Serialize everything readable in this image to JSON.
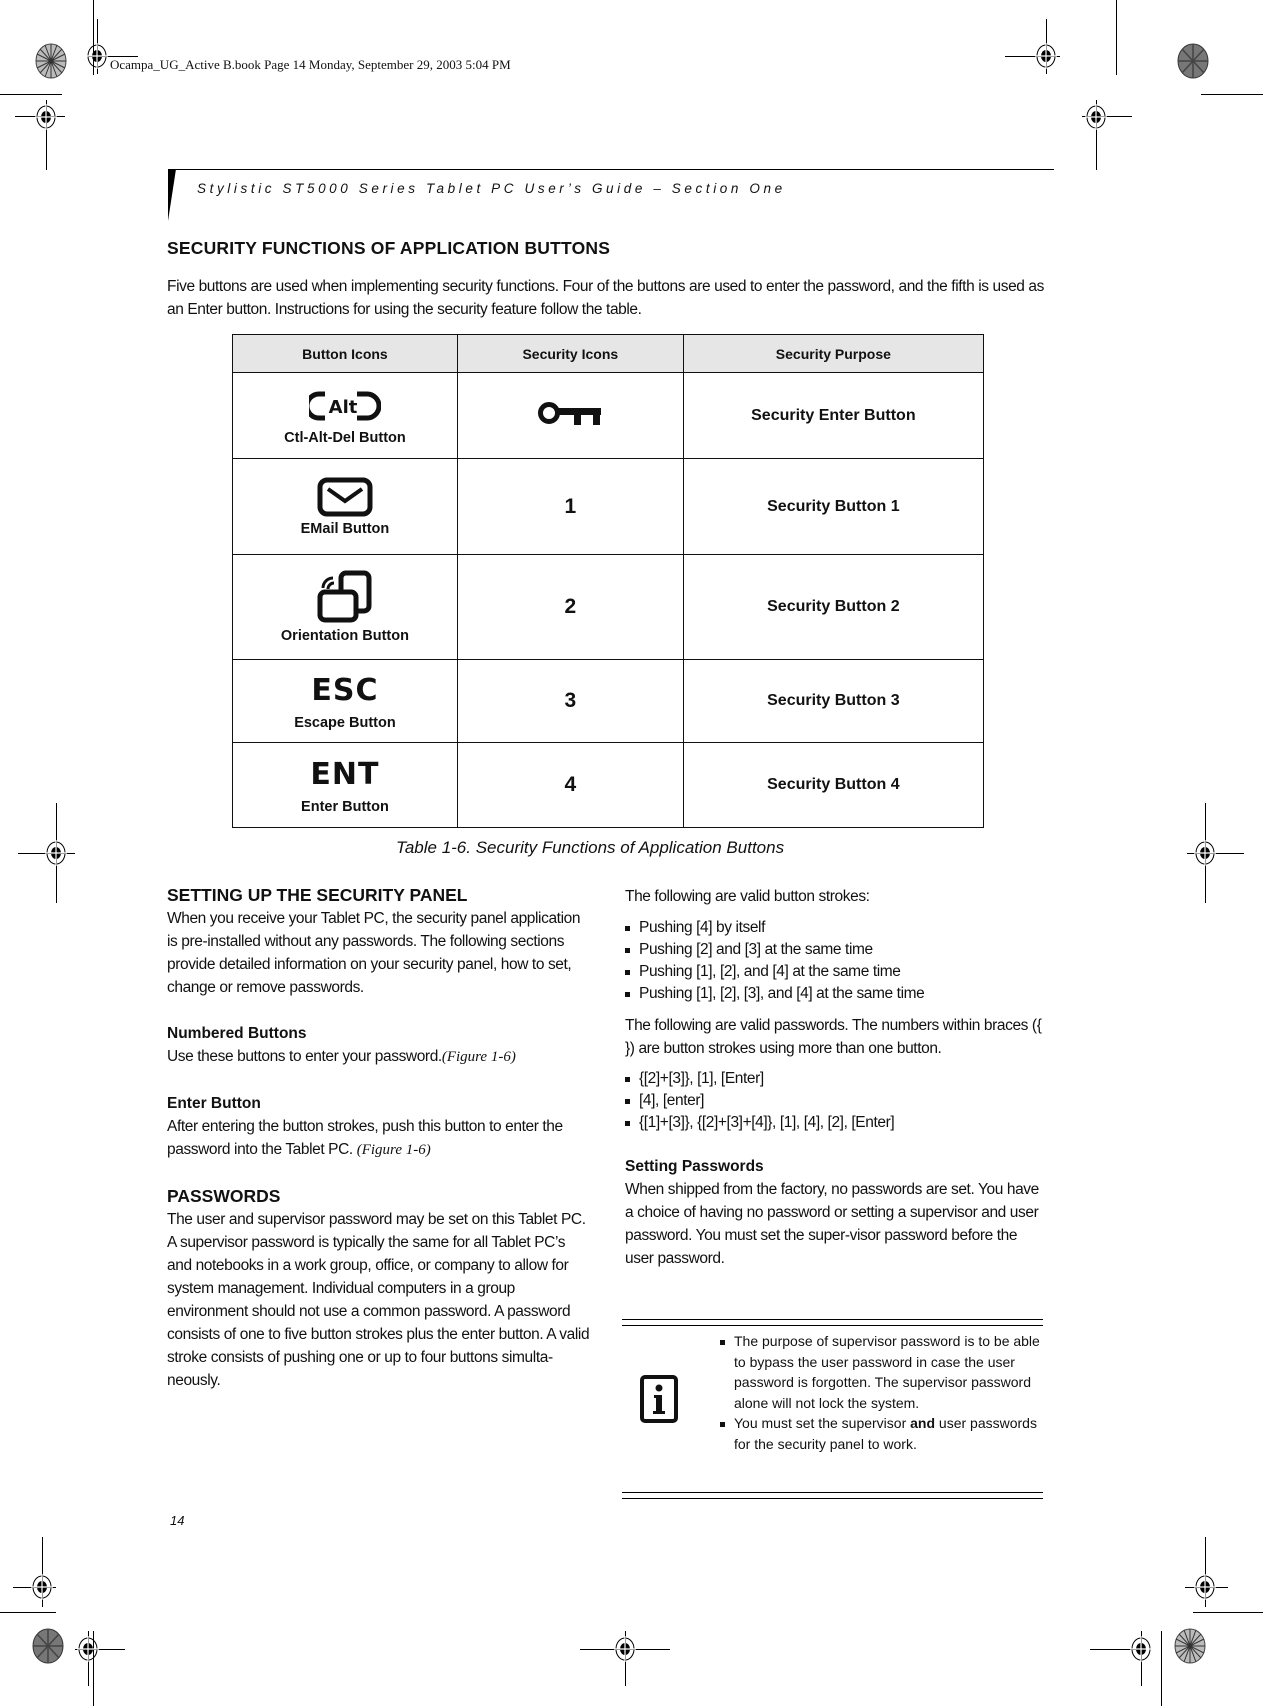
{
  "slug": "Ocampa_UG_Active B.book  Page 14  Monday, September 29, 2003  5:04 PM",
  "running_head": "Stylistic ST5000 Series Tablet PC User’s Guide – Section One",
  "section_title": "SECURITY FUNCTIONS OF APPLICATION BUTTONS",
  "intro": "Five buttons are used when implementing security functions. Four of the buttons are used to enter the password, and the fifth is used as an Enter button. Instructions for using the security feature follow the table.",
  "table": {
    "headers": [
      "Button Icons",
      "Security Icons",
      "Security Purpose"
    ],
    "rows": [
      {
        "button_icon": "alt-key-icon",
        "button_icon_text": "Alt",
        "button_label": "Ctl-Alt-Del Button",
        "security_icon": "key-icon",
        "security_text": "",
        "purpose": "Security Enter Button"
      },
      {
        "button_icon": "email-icon",
        "button_icon_text": "",
        "button_label": "EMail Button",
        "security_icon": "",
        "security_text": "1",
        "purpose": "Security Button 1"
      },
      {
        "button_icon": "orientation-icon",
        "button_icon_text": "",
        "button_label": "Orientation Button",
        "security_icon": "",
        "security_text": "2",
        "purpose": "Security Button 2"
      },
      {
        "button_icon": "esc-icon",
        "button_icon_text": "ESC",
        "button_label": "Escape Button",
        "security_icon": "",
        "security_text": "3",
        "purpose": "Security Button 3"
      },
      {
        "button_icon": "ent-icon",
        "button_icon_text": "ENT",
        "button_label": "Enter Button",
        "security_icon": "",
        "security_text": "4",
        "purpose": "Security Button 4"
      }
    ]
  },
  "table_caption": "Table 1-6. Security Functions of Application Buttons",
  "left": {
    "setup_title": "SETTING UP THE SECURITY PANEL",
    "setup_text": "When you receive your Tablet PC, the security panel application is pre-installed without any passwords. The following sections provide detailed information on your security panel, how to set, change or remove passwords.",
    "numbered_title": "Numbered Buttons",
    "numbered_text": "Use these buttons to enter your password.",
    "numbered_ref": "(Figure 1-6)",
    "enter_title": "Enter Button",
    "enter_text": "After entering the button strokes, push this button to enter the password into the Tablet PC. ",
    "enter_ref": "(Figure 1-6)",
    "passwords_title": "PASSWORDS",
    "passwords_text": "The user and supervisor password may be set on this Tablet PC. A supervisor password is typically the same for all Tablet PC’s and notebooks in a work group, office, or company to allow for system management. Individual computers in a group environment should not use a common password. A password consists of one to five button strokes plus the enter button. A valid stroke consists of pushing one or up to four buttons simulta-neously."
  },
  "right": {
    "strokes_intro": "The following are valid button strokes:",
    "strokes": [
      "Pushing [4] by itself",
      "Pushing [2] and [3] at the same time",
      "Pushing [1], [2], and [4] at the same time",
      "Pushing [1], [2], [3], and [4] at the same time"
    ],
    "passwords_intro": "The following are valid passwords. The numbers within braces ({ }) are button strokes using more than one button.",
    "passwords": [
      "{[2]+[3]}, [1], [Enter]",
      "[4], [enter]",
      "{[1]+[3]}, {[2]+[3]+[4]}, [1], [4], [2], [Enter]"
    ],
    "setting_title": "Setting Passwords",
    "setting_text": "When shipped from the factory, no passwords are set. You have a choice of having no password or setting a supervisor and user password. You must set the super-visor password before the user password."
  },
  "note": {
    "icon": "info-icon",
    "items": [
      {
        "pre": "The purpose of supervisor password is to be able to bypass the user password in case the user password is forgotten. The supervisor password alone will not lock the system.",
        "bold": "",
        "post": ""
      },
      {
        "pre": "You must set the supervisor ",
        "bold": "and",
        "post": " user passwords for the security panel to work."
      }
    ]
  },
  "page_number": "14"
}
